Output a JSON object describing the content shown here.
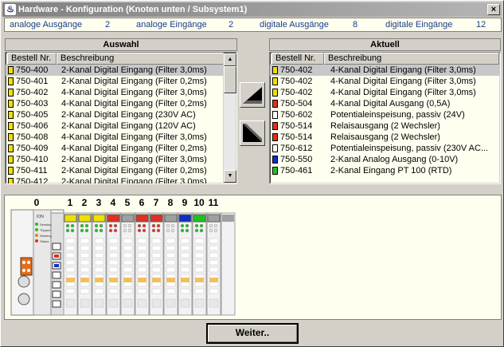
{
  "window": {
    "title": "Hardware - Konfiguration (Knoten unten / Subsystem1)",
    "close_label": "×"
  },
  "summary": {
    "analog_out_label": "analoge Ausgänge",
    "analog_out_count": "2",
    "analog_in_label": "analoge Eingänge",
    "analog_in_count": "2",
    "digital_out_label": "digitale Ausgänge",
    "digital_out_count": "8",
    "digital_in_label": "digitale Eingänge",
    "digital_in_count": "12"
  },
  "auswahl": {
    "title": "Auswahl",
    "col_nr": "Bestell Nr.",
    "col_desc": "Beschreibung",
    "rows": [
      {
        "nr": "750-400",
        "desc": "2-Kanal Digital Eingang (Filter 3,0ms)",
        "color": "#f0e000",
        "selected": true
      },
      {
        "nr": "750-401",
        "desc": "2-Kanal Digital Eingang (Filter 0,2ms)",
        "color": "#f0e000"
      },
      {
        "nr": "750-402",
        "desc": "4-Kanal Digital Eingang (Filter 3,0ms)",
        "color": "#f0e000"
      },
      {
        "nr": "750-403",
        "desc": "4-Kanal Digital Eingang (Filter 0,2ms)",
        "color": "#f0e000"
      },
      {
        "nr": "750-405",
        "desc": "2-Kanal Digital Eingang (230V AC)",
        "color": "#f0e000"
      },
      {
        "nr": "750-406",
        "desc": "2-Kanal Digital Eingang (120V AC)",
        "color": "#f0e000"
      },
      {
        "nr": "750-408",
        "desc": "4-Kanal Digital Eingang (Filter 3,0ms)",
        "color": "#f0e000"
      },
      {
        "nr": "750-409",
        "desc": "4-Kanal Digital Eingang (Filter 0,2ms)",
        "color": "#f0e000"
      },
      {
        "nr": "750-410",
        "desc": "2-Kanal Digital Eingang (Filter 3,0ms)",
        "color": "#f0e000"
      },
      {
        "nr": "750-411",
        "desc": "2-Kanal Digital Eingang (Filter 0,2ms)",
        "color": "#f0e000"
      },
      {
        "nr": "750-412",
        "desc": "2-Kanal Digital Eingang (Filter 3,0ms)",
        "color": "#f0e000"
      }
    ]
  },
  "aktuell": {
    "title": "Aktuell",
    "col_nr": "Bestell Nr.",
    "col_desc": "Beschreibung",
    "rows": [
      {
        "nr": "750-402",
        "desc": "4-Kanal Digital Eingang (Filter 3,0ms)",
        "color": "#f0e000",
        "selected": true
      },
      {
        "nr": "750-402",
        "desc": "4-Kanal Digital Eingang (Filter 3,0ms)",
        "color": "#f0e000"
      },
      {
        "nr": "750-402",
        "desc": "4-Kanal Digital Eingang (Filter 3,0ms)",
        "color": "#f0e000"
      },
      {
        "nr": "750-504",
        "desc": "4-Kanal Digital Ausgang (0,5A)",
        "color": "#e03020"
      },
      {
        "nr": "750-602",
        "desc": "Potentialeinspeisung, passiv (24V)",
        "color": "#ffffff"
      },
      {
        "nr": "750-514",
        "desc": "Relaisausgang (2 Wechsler)",
        "color": "#e03020"
      },
      {
        "nr": "750-514",
        "desc": "Relaisausgang (2 Wechsler)",
        "color": "#e03020"
      },
      {
        "nr": "750-612",
        "desc": "Potentialeinspeisung, passiv (230V AC...",
        "color": "#ffffff"
      },
      {
        "nr": "750-550",
        "desc": "2-Kanal Analog Ausgang (0-10V)",
        "color": "#1030c0"
      },
      {
        "nr": "750-461",
        "desc": "2-Kanal Eingang PT 100 (RTD)",
        "color": "#20c020"
      }
    ]
  },
  "rack": {
    "slot_numbers": [
      "0",
      "1",
      "2",
      "3",
      "4",
      "5",
      "6",
      "7",
      "8",
      "9",
      "10",
      "11"
    ],
    "module_colors": [
      "#f0e000",
      "#f0e000",
      "#f0e000",
      "#e03020",
      "#a0a0a0",
      "#e03020",
      "#e03020",
      "#a0a0a0",
      "#1030c0",
      "#20c020",
      "#a0a0a0"
    ],
    "coupler_label": "ION",
    "coupler_led_labels": [
      "Sensing",
      "Tripped",
      "Warning",
      "Status"
    ]
  },
  "footer": {
    "next_label": "Weiter.."
  }
}
